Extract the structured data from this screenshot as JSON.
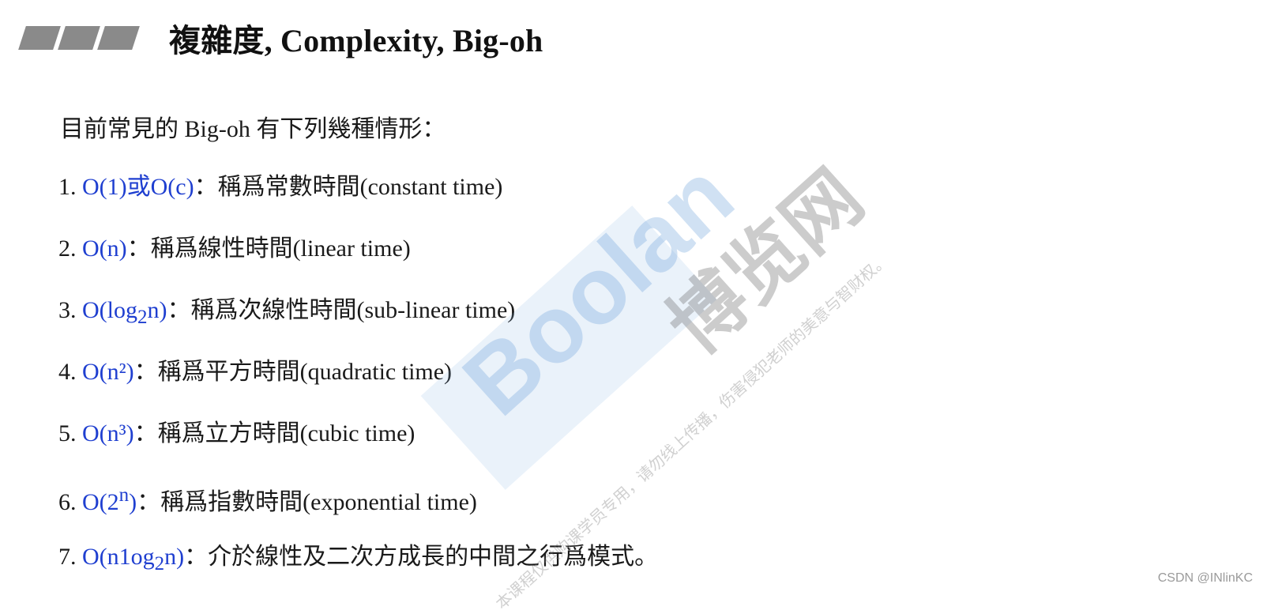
{
  "slide": {
    "title": "複雜度, Complexity, Big-oh",
    "intro": "目前常見的 Big-oh 有下列幾種情形："
  },
  "items": [
    {
      "num": "1. ",
      "notation": "O(1)或O(c)",
      "desc": "：稱爲常數時間(constant time)"
    },
    {
      "num": "2. ",
      "notation": "O(n)",
      "desc": "：稱爲線性時間(linear time)"
    },
    {
      "num": "3. ",
      "notation_pre": "O(log",
      "notation_sub": "2",
      "notation_post": "n)",
      "desc": "：稱爲次線性時間(sub-linear time)"
    },
    {
      "num": "4. ",
      "notation": "O(n²)",
      "desc": "：稱爲平方時間(quadratic time)"
    },
    {
      "num": "5. ",
      "notation": "O(n³)",
      "desc": "：稱爲立方時間(cubic time)"
    },
    {
      "num": "6. ",
      "notation_pre": "O(2",
      "notation_sup": "n",
      "notation_post": ")",
      "desc": "：稱爲指數時間(exponential time)"
    },
    {
      "num": "7. ",
      "notation_pre": "O(n1og",
      "notation_sub": "2",
      "notation_post": "n)",
      "desc": "：介於線性及二次方成長的中間之行爲模式。"
    }
  ],
  "watermark": {
    "brand_en": "Boolan",
    "brand_cn": "博览网",
    "notice": "本课程仅供购课学员专用，请勿线上传播，伤害侵犯老师的美意与智财权。"
  },
  "credit": "CSDN @INlinKC",
  "colors": {
    "notation_blue": "#1f3fd0",
    "bar_gray": "#8a8a8a"
  }
}
